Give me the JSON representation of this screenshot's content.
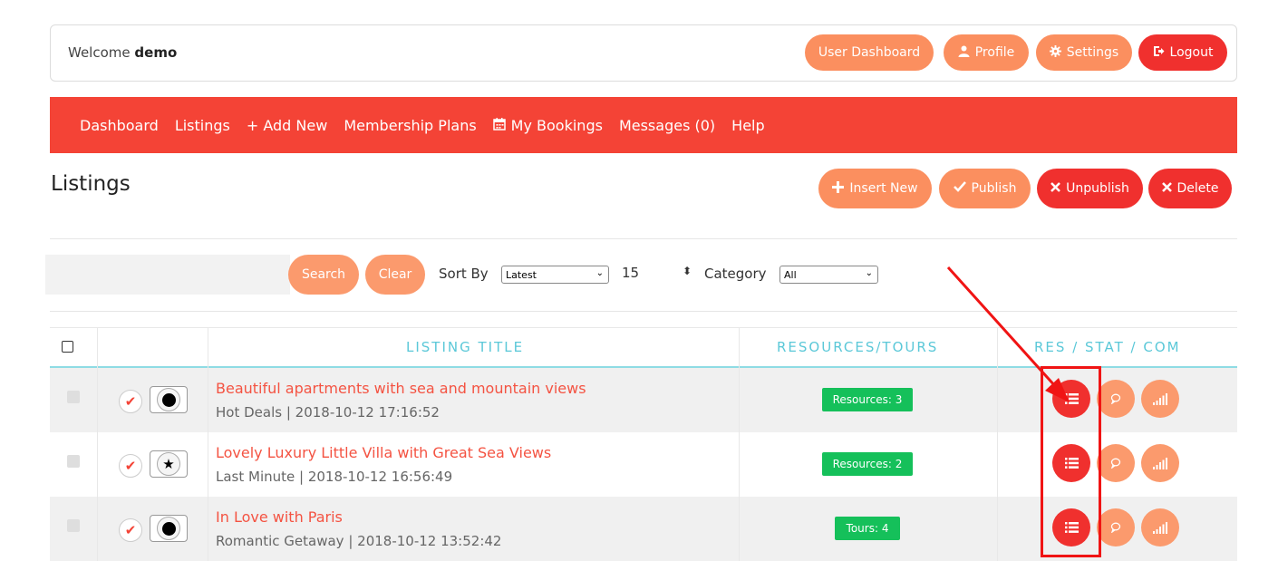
{
  "topbar": {
    "welcome_prefix": "Welcome",
    "username": "demo",
    "buttons": {
      "user_dashboard": "User Dashboard",
      "profile": "Profile",
      "settings": "Settings",
      "logout": "Logout"
    }
  },
  "nav": {
    "dashboard": "Dashboard",
    "listings": "Listings",
    "add_new": "+ Add New",
    "membership_plans": "Membership Plans",
    "my_bookings": "My Bookings",
    "messages": "Messages (0)",
    "help": "Help"
  },
  "page": {
    "title": "Listings",
    "actions": {
      "insert_new": "Insert New",
      "publish": "Publish",
      "unpublish": "Unpublish",
      "delete": "Delete"
    }
  },
  "filters": {
    "search_value": "",
    "search_button": "Search",
    "clear_button": "Clear",
    "sort_by_label": "Sort By",
    "sort_by_value": "Latest",
    "per_page_value": "15",
    "category_label": "Category",
    "category_value": "All"
  },
  "table": {
    "headers": {
      "listing_title": "LISTING TITLE",
      "resources_tours": "RESOURCES/TOURS",
      "res_stat_com": "RES / STAT / COM"
    },
    "rows": [
      {
        "title": "Beautiful apartments with sea and mountain views",
        "meta": "Hot Deals | 2018-10-12 17:16:52",
        "badge": "Resources: 3",
        "featured_icon": "dot"
      },
      {
        "title": "Lovely Luxury Little Villa with Great Sea Views",
        "meta": "Last Minute | 2018-10-12 16:56:49",
        "badge": "Resources: 2",
        "featured_icon": "star"
      },
      {
        "title": "In Love with Paris",
        "meta": "Romantic Getaway | 2018-10-12 13:52:42",
        "badge": "Tours: 4",
        "featured_icon": "dot"
      }
    ]
  },
  "colors": {
    "brand_red": "#f44336",
    "orange": "#fb8f5f",
    "badge_green": "#15c05a",
    "header_teal": "#5bc8d8",
    "annotation_red": "#f01414"
  }
}
